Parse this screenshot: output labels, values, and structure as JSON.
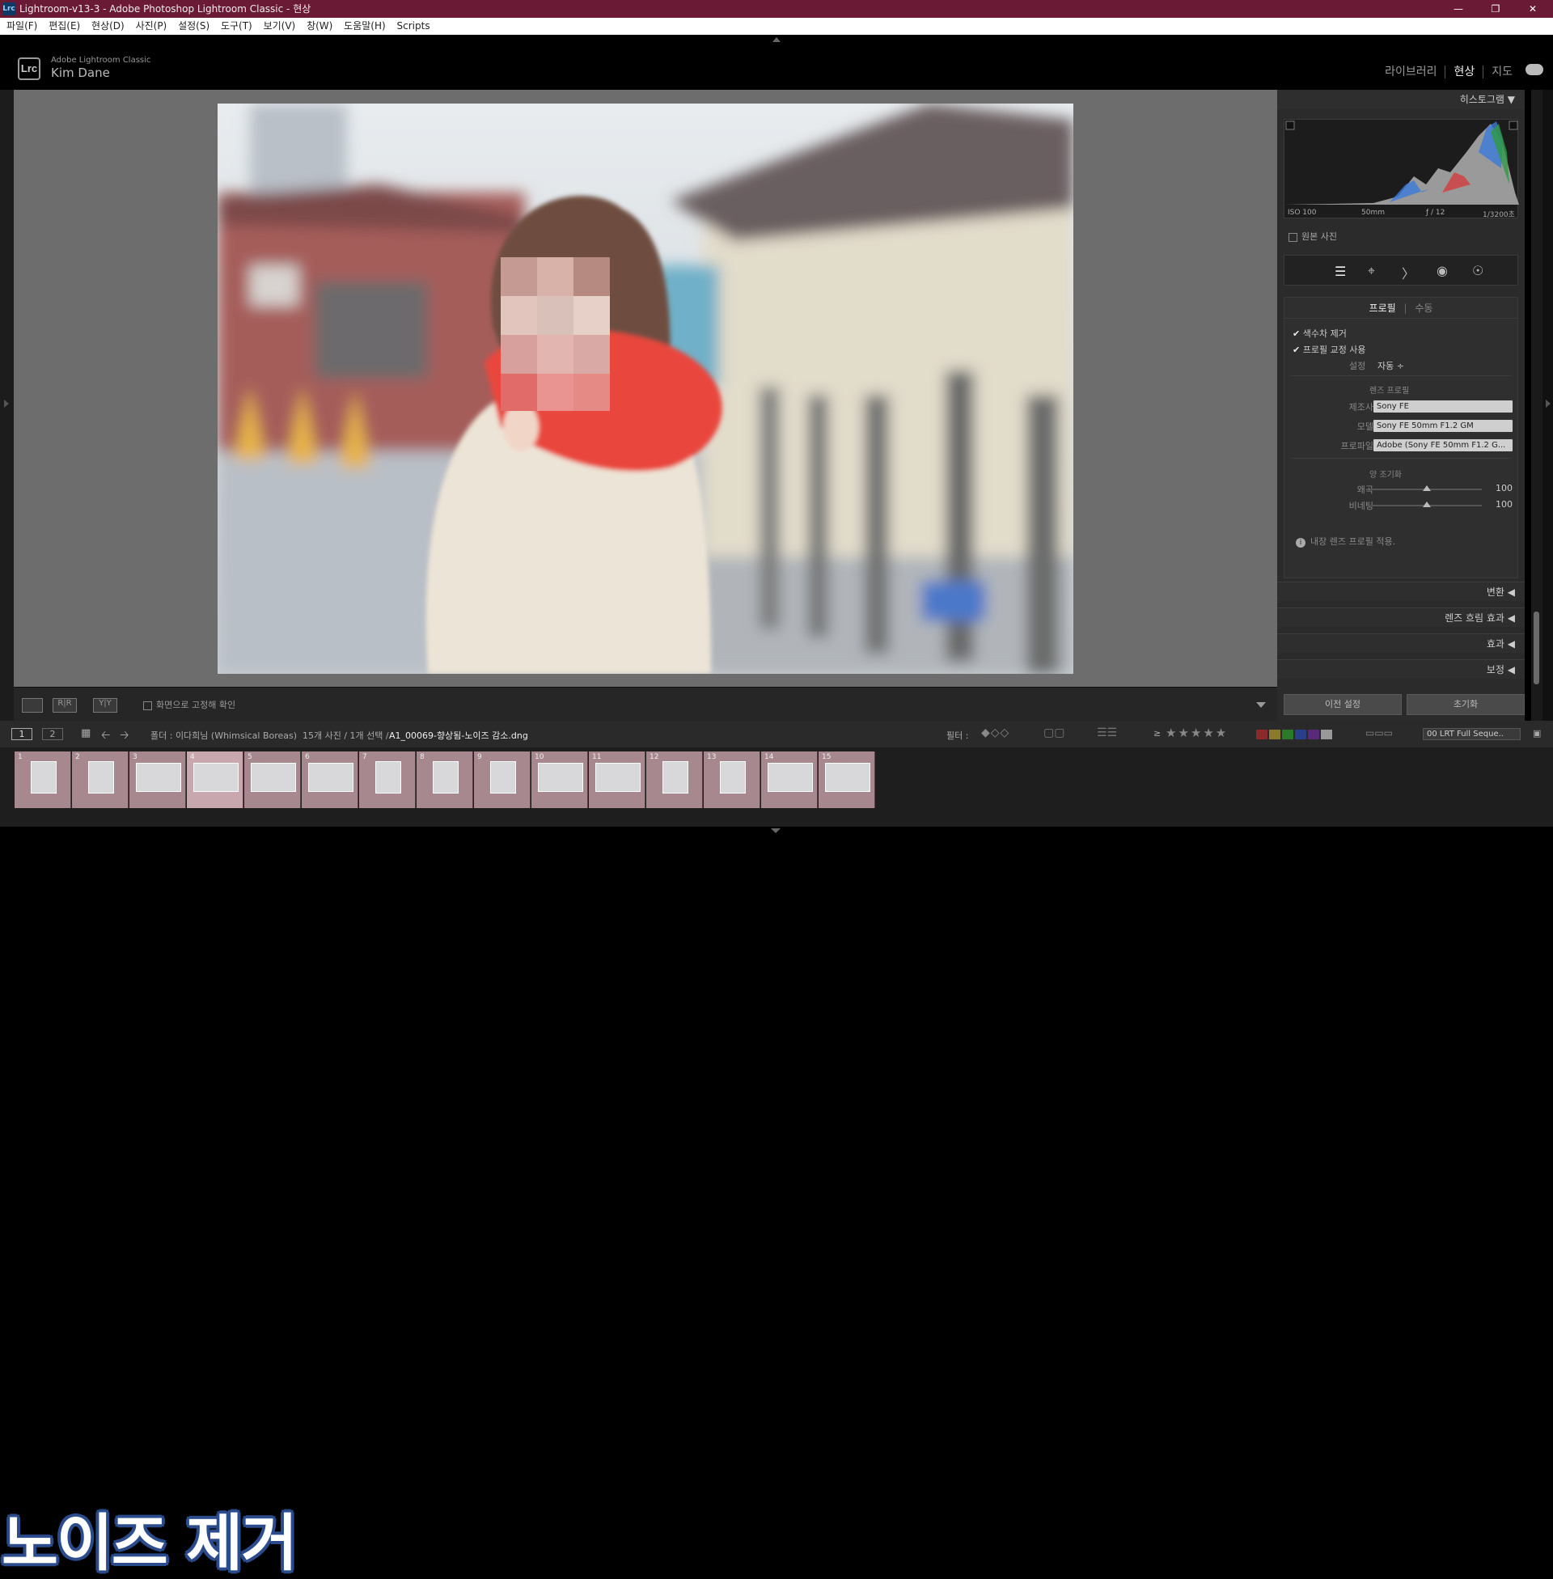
{
  "titlebar": {
    "app_icon": "Lrc",
    "title": "Lightroom-v13-3 - Adobe Photoshop Lightroom Classic - 현상"
  },
  "menu": [
    "파일(F)",
    "편집(E)",
    "현상(D)",
    "사진(P)",
    "설정(S)",
    "도구(T)",
    "보기(V)",
    "창(W)",
    "도움말(H)",
    "Scripts"
  ],
  "header": {
    "logo": "Lrc",
    "product": "Adobe Lightroom Classic",
    "user": "Kim Dane",
    "modules": [
      "라이브러리",
      "현상",
      "지도"
    ],
    "active_module": "현상"
  },
  "toolbar": {
    "confirm_label": "화면으로 고정해 확인"
  },
  "right": {
    "histogram_title": "히스토그램",
    "histo_info": {
      "iso": "ISO 100",
      "focal": "50mm",
      "aperture": "ƒ / 12",
      "shutter": "1/3200초"
    },
    "original_photo": "원본 사진",
    "tabs": {
      "profile": "프로필",
      "manual": "수동"
    },
    "remove_ca": "색수차 제거",
    "enable_profile": "프로필 교정 사용",
    "setup_label": "설정",
    "setup_value": "자동 ÷",
    "lens_profile_title": "렌즈 프로필",
    "make_label": "제조사",
    "make_value": "Sony FE",
    "model_label": "모델",
    "model_value": "Sony FE 50mm F1.2 GM",
    "profile_label": "프로파일",
    "profile_value": "Adobe (Sony FE 50mm F1.2 G...",
    "amount_title": "양 조기화",
    "distortion_label": "왜곡",
    "distortion_value": "100",
    "distortion_level": 100,
    "vignetting_label": "비네팅",
    "vignetting_value": "100",
    "vignetting_level": 100,
    "info_note": "내장 렌즈 프로필 적용.",
    "sections": [
      "변환",
      "렌즈 흐림 효과",
      "효과",
      "보정"
    ],
    "prev_button": "이전 설정",
    "reset_button": "초기화"
  },
  "filmbar": {
    "page1": "1",
    "page2": "2",
    "folder": "폴더 : 이다희님 (Whimsical Boreas)",
    "count": "15개 사진 / 1개 선택 /",
    "filename": "A1_00069-향상됨-노이즈 감소.dng",
    "filter_label": "필터 :",
    "rating_op": "≥",
    "preset": "00 LRT Full Seque.."
  },
  "filmstrip": [
    {
      "n": "1"
    },
    {
      "n": "2"
    },
    {
      "n": "3"
    },
    {
      "n": "4"
    },
    {
      "n": "5"
    },
    {
      "n": "6"
    },
    {
      "n": "7"
    },
    {
      "n": "8"
    },
    {
      "n": "9"
    },
    {
      "n": "10"
    },
    {
      "n": "11"
    },
    {
      "n": "12"
    },
    {
      "n": "13"
    },
    {
      "n": "14"
    },
    {
      "n": "15"
    }
  ],
  "overlay_caption": "노이즈 제거",
  "colors": {
    "titlebar": "#6b1a35",
    "thumb_bg": "#a7888f",
    "caption_stroke": "#2b4c8c"
  }
}
